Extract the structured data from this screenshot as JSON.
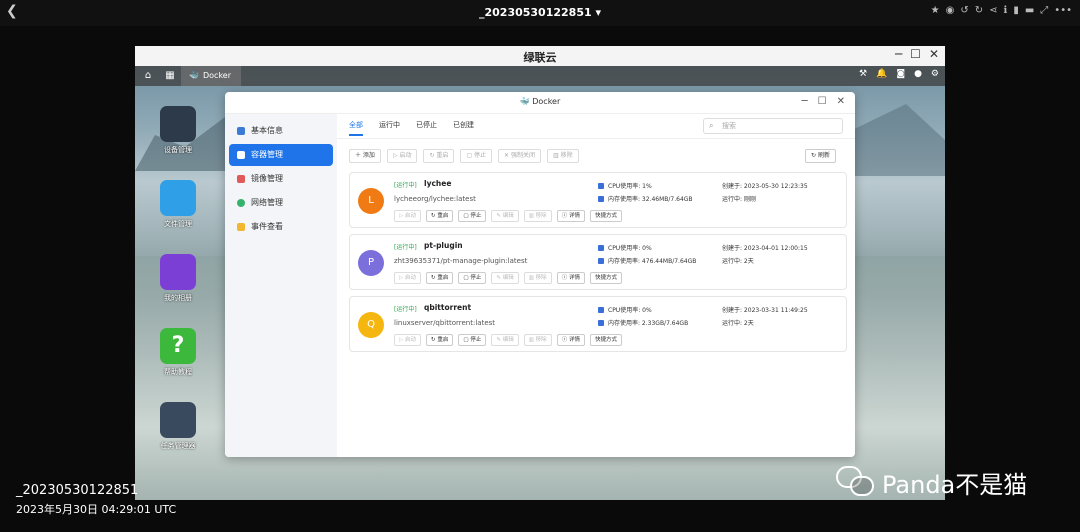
{
  "viewer": {
    "title": "_20230530122851",
    "back_icon": "chevron-left-icon"
  },
  "window": {
    "title": "绿联云"
  },
  "taskbar": {
    "docker_label": "Docker"
  },
  "desktop_icons": [
    {
      "label": "设备管理",
      "color": "#2c3a4a"
    },
    {
      "label": "文件管理",
      "color": "#2fa0e8"
    },
    {
      "label": "我的相册",
      "color": "#7b3fd6"
    },
    {
      "label": "帮助教程",
      "color": "#3cb83c"
    },
    {
      "label": "任务管理器",
      "color": "#3a4a5e"
    }
  ],
  "docker": {
    "title": "Docker",
    "sidebar": [
      {
        "label": "基本信息",
        "icon": "docker-icon",
        "color": "#3a7bd5"
      },
      {
        "label": "容器管理",
        "icon": "cube-icon",
        "color": "#ffffff"
      },
      {
        "label": "镜像管理",
        "icon": "image-icon",
        "color": "#e05a5a"
      },
      {
        "label": "网络管理",
        "icon": "globe-icon",
        "color": "#35b36a"
      },
      {
        "label": "事件查看",
        "icon": "mail-icon",
        "color": "#f2b630"
      }
    ],
    "tabs": [
      "全部",
      "运行中",
      "已停止",
      "已创建"
    ],
    "search_placeholder": "搜索",
    "toolbar": [
      "添加",
      "启动",
      "重启",
      "停止",
      "强制关闭",
      "移除"
    ],
    "refresh_label": "刷新",
    "card_buttons": [
      "启动",
      "重启",
      "停止",
      "编辑",
      "移除",
      "详情",
      "快捷方式"
    ],
    "containers": [
      {
        "avatar": "L",
        "avatar_color": "#f07b14",
        "status": "[运行中]",
        "name": "lychee",
        "image": "lycheeorg/lychee:latest",
        "cpu": "CPU使用率: 1%",
        "mem": "内存使用率: 32.46MB/7.64GB",
        "created": "创建于: 2023-05-30 12:23:35",
        "running": "运行中: 刚刚"
      },
      {
        "avatar": "P",
        "avatar_color": "#7b6fdc",
        "status": "[运行中]",
        "name": "pt-plugin",
        "image": "zht39635371/pt-manage-plugin:latest",
        "cpu": "CPU使用率: 0%",
        "mem": "内存使用率: 476.44MB/7.64GB",
        "created": "创建于: 2023-04-01 12:00:15",
        "running": "运行中: 2天"
      },
      {
        "avatar": "Q",
        "avatar_color": "#f5b60f",
        "status": "[运行中]",
        "name": "qbittorrent",
        "image": "linuxserver/qbittorrent:latest",
        "cpu": "CPU使用率: 0%",
        "mem": "内存使用率: 2.33GB/7.64GB",
        "created": "创建于: 2023-03-31 11:49:25",
        "running": "运行中: 2天"
      }
    ]
  },
  "footer": {
    "title": "_20230530122851",
    "date": "2023年5月30日 04:29:01 UTC"
  },
  "watermark": {
    "text": "Panda不是猫"
  }
}
